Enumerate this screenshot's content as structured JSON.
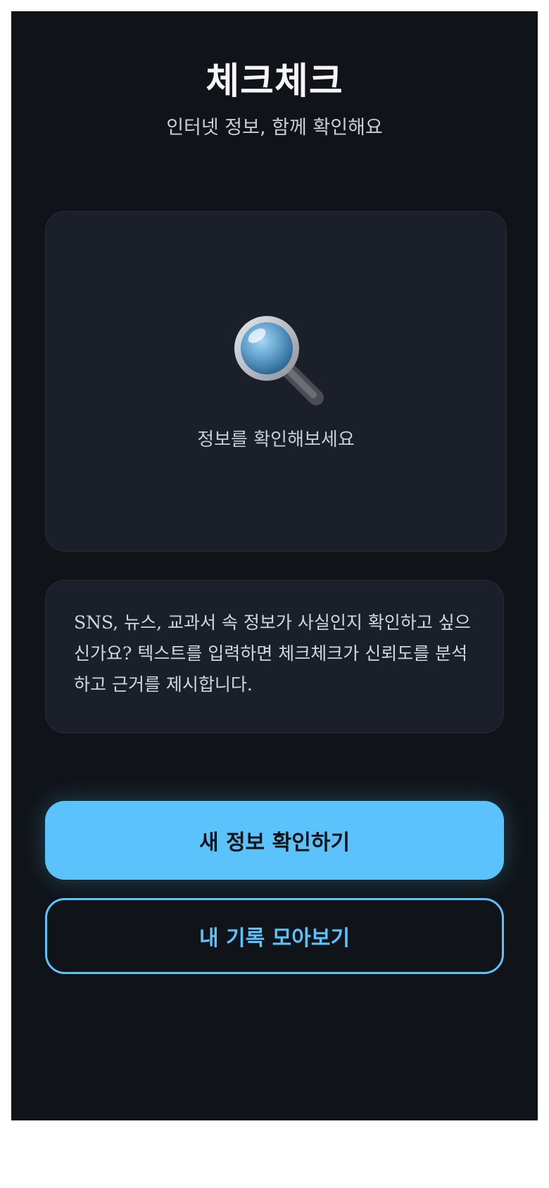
{
  "app": {
    "title": "체크체크",
    "subtitle": "인터넷 정보, 함께 확인해요"
  },
  "hero": {
    "icon": "magnifying-glass-icon",
    "text": "정보를 확인해보세요"
  },
  "info": {
    "text": "SNS, 뉴스, 교과서 속 정보가 사실인지 확인하고 싶으신가요? 텍스트를 입력하면 체크체크가 신뢰도를 분석하고 근거를 제시합니다."
  },
  "actions": {
    "primary_label": "새 정보 확인하기",
    "secondary_label": "내 기록 모아보기"
  },
  "colors": {
    "background": "#101418",
    "card": "#1b1f2a",
    "accent": "#5bc2fb"
  }
}
